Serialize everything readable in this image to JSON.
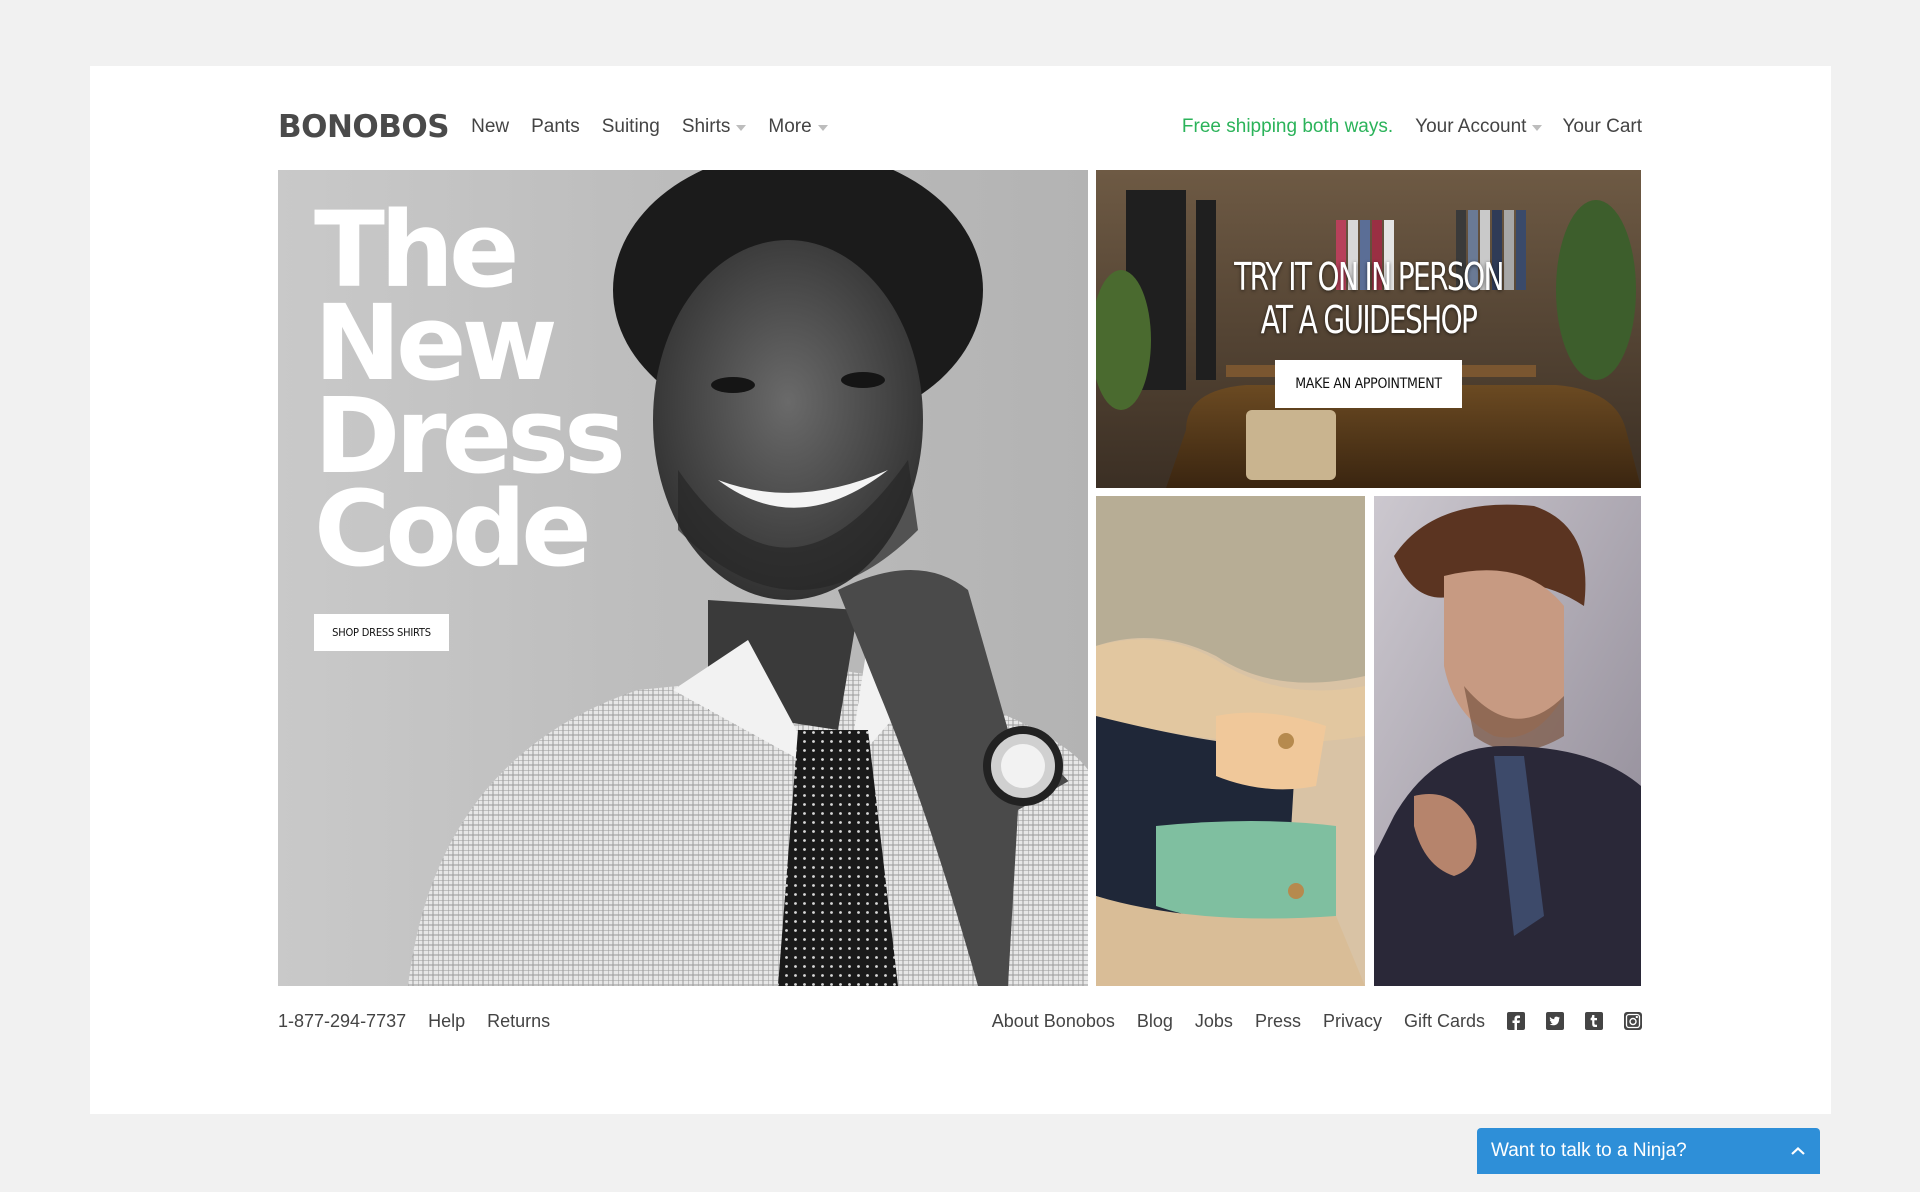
{
  "header": {
    "logo": "BONOBOS",
    "nav": [
      {
        "label": "New",
        "dropdown": false
      },
      {
        "label": "Pants",
        "dropdown": false
      },
      {
        "label": "Suiting",
        "dropdown": false
      },
      {
        "label": "Shirts",
        "dropdown": true
      },
      {
        "label": "More",
        "dropdown": true
      }
    ],
    "promo": "Free shipping both ways.",
    "account": "Your Account",
    "cart": "Your Cart"
  },
  "hero": {
    "title_lines": [
      "The",
      "New",
      "Dress",
      "Code"
    ],
    "cta": "SHOP DRESS SHIRTS"
  },
  "guideshop": {
    "title_line1": "TRY IT ON IN PERSON",
    "title_line2": "AT A GUIDESHOP",
    "cta": "MAKE AN APPOINTMENT"
  },
  "footer": {
    "phone": "1-877-294-7737",
    "left_links": [
      "Help",
      "Returns"
    ],
    "right_links": [
      "About Bonobos",
      "Blog",
      "Jobs",
      "Press",
      "Privacy",
      "Gift Cards"
    ],
    "social_icons": [
      "facebook-icon",
      "twitter-icon",
      "tumblr-icon",
      "instagram-icon"
    ]
  },
  "chat": {
    "label": "Want to talk to a Ninja?"
  },
  "colors": {
    "promo_green": "#2bb35a",
    "chat_blue": "#2e8fd8",
    "page_bg": "#f1f1f1"
  }
}
